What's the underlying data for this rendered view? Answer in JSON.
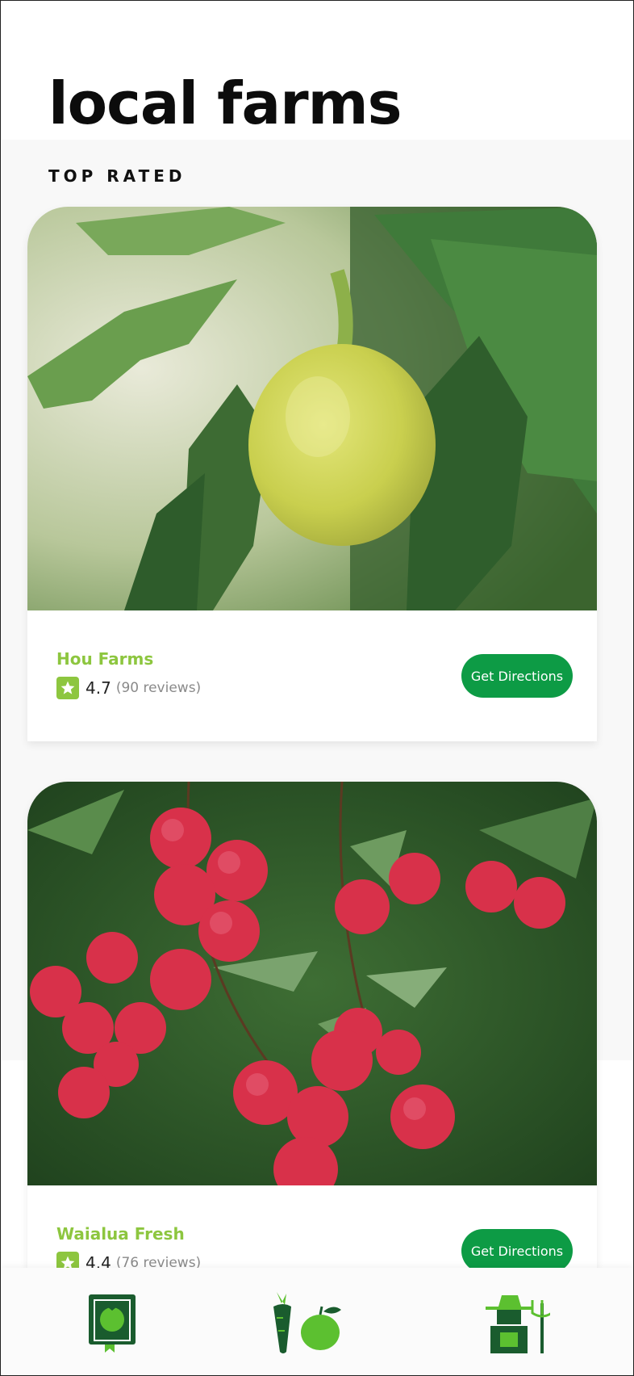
{
  "page": {
    "title": "local farms",
    "section_label": "TOP RATED"
  },
  "farms": [
    {
      "name": "Hou Farms",
      "rating": "4.7",
      "reviews": "(90 reviews)",
      "button_label": "Get Directions",
      "photo": "breadfruit-tree-photo"
    },
    {
      "name": "Waialua Fresh",
      "rating": "4.4",
      "reviews": "(76 reviews)",
      "button_label": "Get Directions",
      "photo": "lychee-tree-photo"
    }
  ],
  "nav": {
    "items": [
      {
        "icon": "recipe-book-icon"
      },
      {
        "icon": "produce-icon"
      },
      {
        "icon": "farmer-icon"
      }
    ]
  },
  "colors": {
    "accent_green": "#8dc63f",
    "button_green": "#0d9b45",
    "dark_green": "#1a5c2e",
    "bright_green": "#5cc030"
  }
}
